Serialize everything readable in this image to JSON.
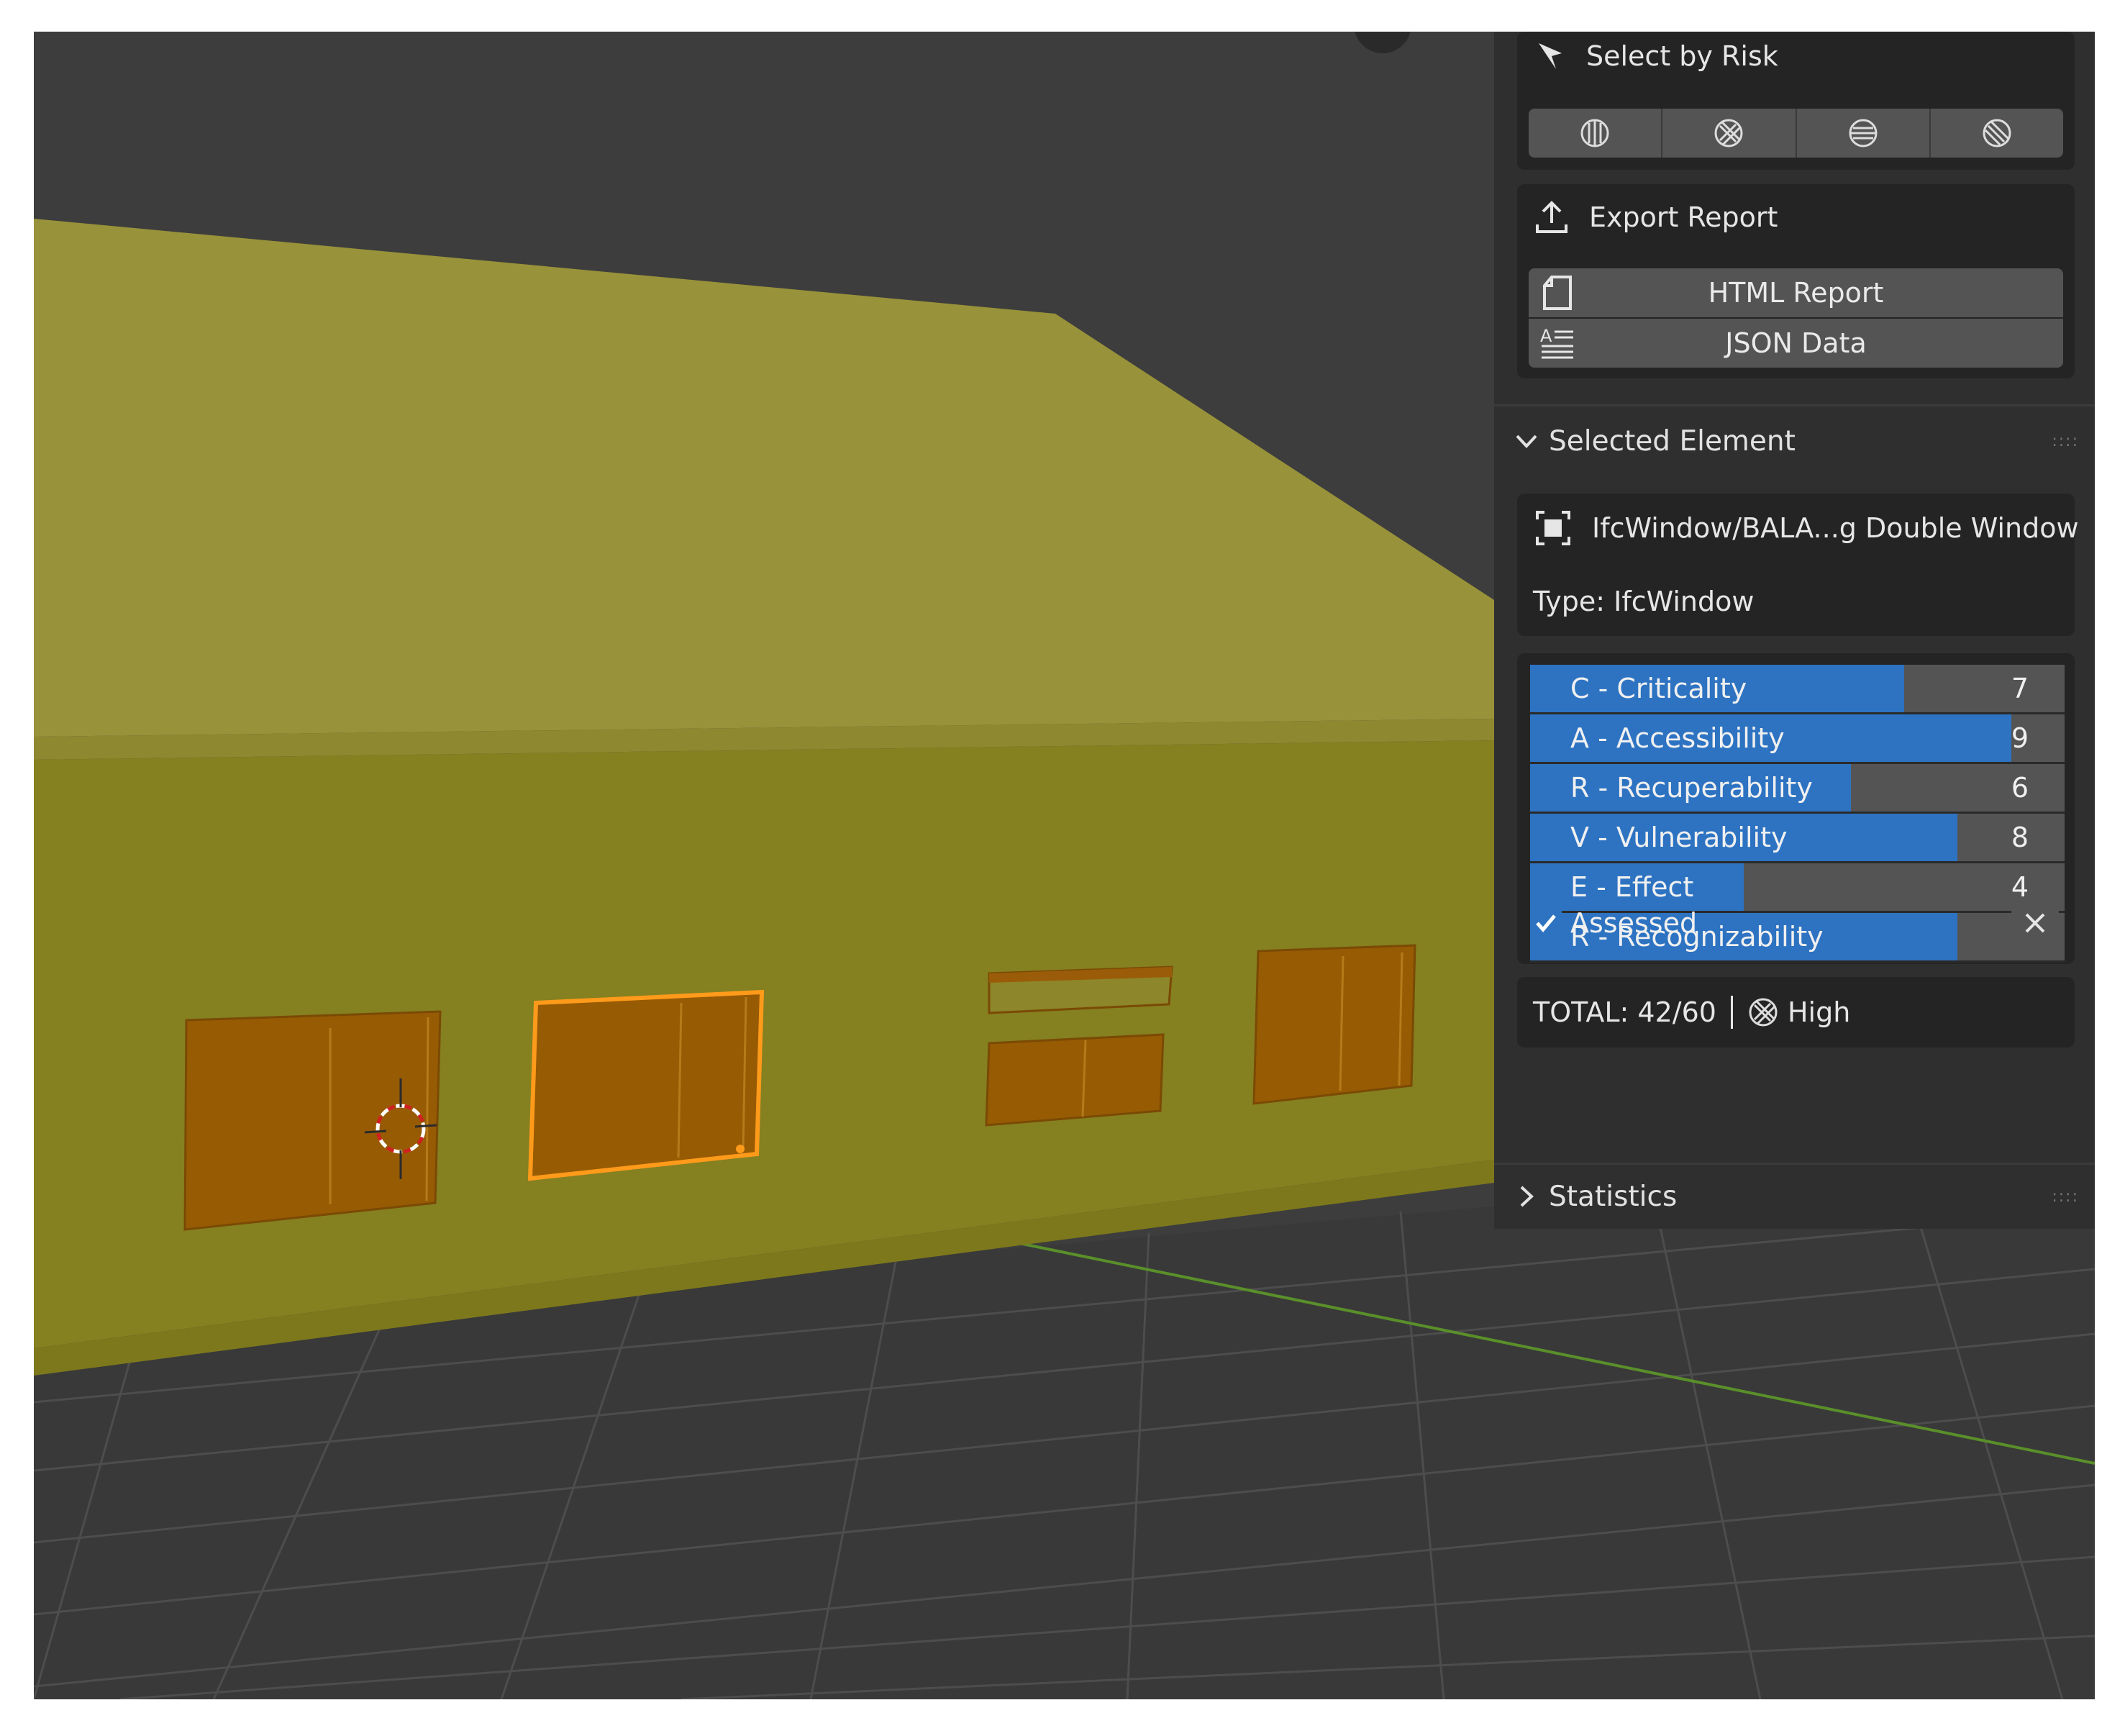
{
  "panel": {
    "select_by_risk": {
      "title": "Select by Risk",
      "title_icon": "cursor-arrow-icon",
      "buttons": [
        {
          "icon": "risk-vertical-hatch-icon"
        },
        {
          "icon": "risk-cross-hatch-icon"
        },
        {
          "icon": "risk-horizontal-hatch-icon"
        },
        {
          "icon": "risk-diagonal-hatch-icon"
        }
      ]
    },
    "export_report": {
      "title": "Export Report",
      "title_icon": "export-icon",
      "html_label": "HTML Report",
      "html_icon": "file-icon",
      "json_label": "JSON Data",
      "json_icon": "text-data-icon"
    },
    "selected_element": {
      "header": "Selected Element",
      "element_name": "IfcWindow/BALA...g Double Window",
      "element_icon": "object-select-icon",
      "type_text": "Type: IfcWindow",
      "scores": [
        {
          "label": "C - Criticality",
          "value": 7,
          "max": 10
        },
        {
          "label": "A - Accessibility",
          "value": 9,
          "max": 10
        },
        {
          "label": "R - Recuperability",
          "value": 6,
          "max": 10
        },
        {
          "label": "V - Vulnerability",
          "value": 8,
          "max": 10
        },
        {
          "label": "E - Effect",
          "value": 4,
          "max": 10
        },
        {
          "label": "R - Recognizability",
          "value": 8,
          "max": 10
        }
      ],
      "assessed_label": "Assessed",
      "assessed": true,
      "total_text": "TOTAL: 42/60",
      "risk_level": "High"
    },
    "statistics": {
      "header": "Statistics"
    }
  },
  "colors": {
    "accent": "#2d73c2",
    "building_wall": "#858020",
    "building_roof": "#98923a",
    "windows": "#975b03",
    "selection": "#ff9a1a"
  }
}
